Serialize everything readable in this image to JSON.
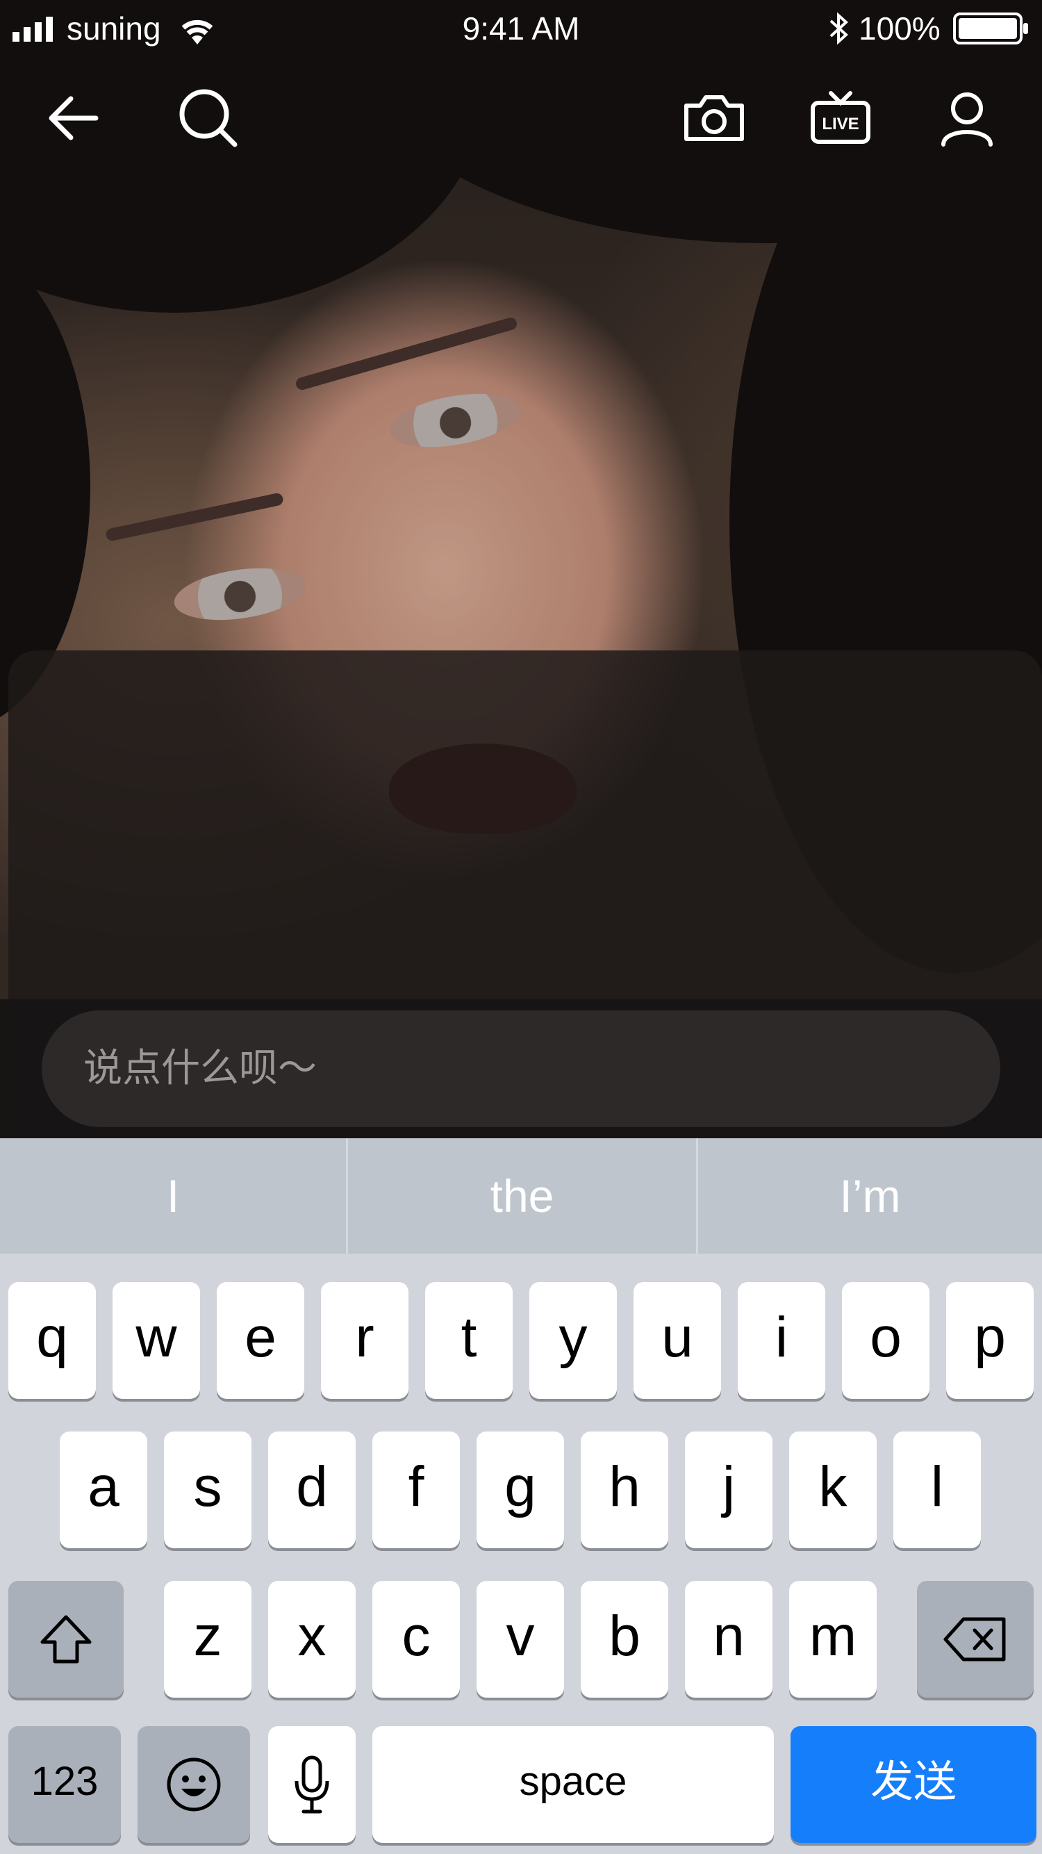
{
  "status_bar": {
    "carrier": "suning",
    "time": "9:41 AM",
    "battery_percent": "100%"
  },
  "nav": {
    "icons": [
      "back-arrow-icon",
      "search-icon",
      "camera-icon",
      "live-tv-icon",
      "user-icon"
    ],
    "live_badge_text": "LIVE"
  },
  "comment": {
    "placeholder": "说点什么呗～"
  },
  "keyboard": {
    "suggestions": [
      "I",
      "the",
      "I’m"
    ],
    "row1": [
      "q",
      "w",
      "e",
      "r",
      "t",
      "y",
      "u",
      "i",
      "o",
      "p"
    ],
    "row2": [
      "a",
      "s",
      "d",
      "f",
      "g",
      "h",
      "j",
      "k",
      "l"
    ],
    "row3": [
      "z",
      "x",
      "c",
      "v",
      "b",
      "n",
      "m"
    ],
    "numbers_label": "123",
    "space_label": "space",
    "send_label": "发送",
    "send_color": "#157efb"
  }
}
